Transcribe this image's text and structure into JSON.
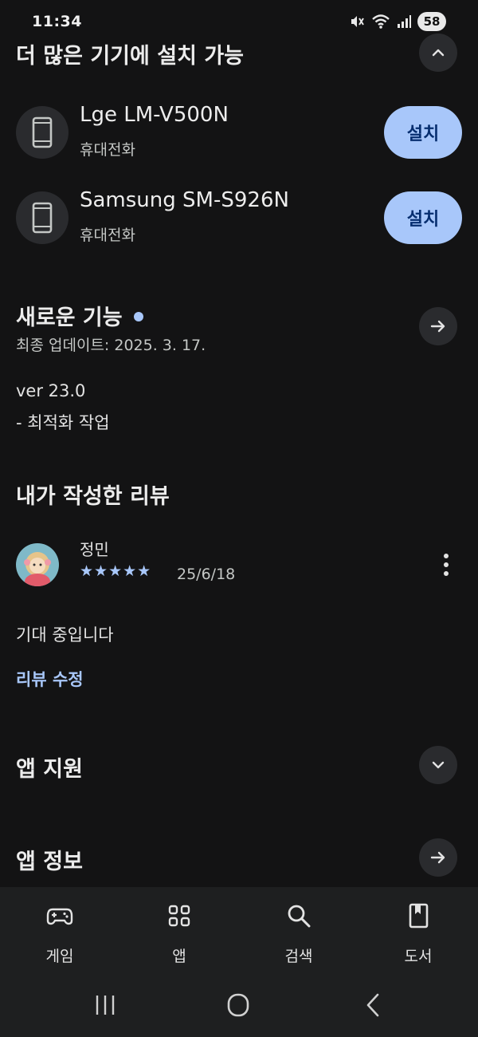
{
  "status_bar": {
    "time": "11:34",
    "battery": "58"
  },
  "install_section": {
    "title": "더 많은 기기에 설치 가능",
    "devices": [
      {
        "name": "Lge LM-V500N",
        "type": "휴대전화",
        "button": "설치"
      },
      {
        "name": "Samsung SM-S926N",
        "type": "휴대전화",
        "button": "설치"
      }
    ]
  },
  "whats_new": {
    "title": "새로운 기능",
    "updated": "최종 업데이트: 2025. 3. 17.",
    "version": "ver 23.0",
    "notes": "- 최적화 작업"
  },
  "my_review": {
    "title": "내가 작성한 리뷰",
    "reviewer": "정민",
    "stars": "★★★★★",
    "rating": 5,
    "date": "25/6/18",
    "text": "기대 중입니다",
    "edit_link": "리뷰 수정"
  },
  "app_support": {
    "title": "앱 지원"
  },
  "app_info": {
    "title": "앱 정보"
  },
  "bottom_nav": {
    "items": [
      {
        "label": "게임",
        "icon": "gamepad-icon"
      },
      {
        "label": "앱",
        "icon": "apps-grid-icon"
      },
      {
        "label": "검색",
        "icon": "search-icon"
      },
      {
        "label": "도서",
        "icon": "book-icon"
      }
    ]
  },
  "colors": {
    "accent": "#a8c7fa",
    "background": "#131314",
    "surface": "#1e1f20"
  }
}
